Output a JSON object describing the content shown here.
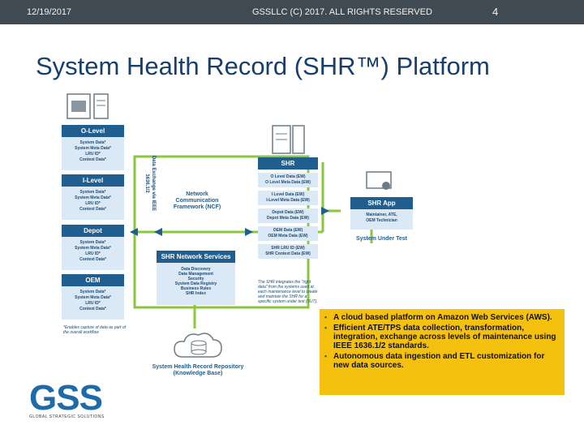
{
  "header": {
    "date": "12/19/2017",
    "copyright": "GSSLLC (C) 2017. ALL RIGHTS RESERVED",
    "page": "4"
  },
  "title": "System Health Record (SHR™) Platform",
  "diagram": {
    "levels": [
      {
        "name": "O-Level",
        "items": [
          "System Data*",
          "System Meta Data*",
          "LRU ID*",
          "Context Data*"
        ]
      },
      {
        "name": "I-Level",
        "items": [
          "System Data*",
          "System Meta Data*",
          "LRU ID*",
          "Context Data*"
        ]
      },
      {
        "name": "Depot",
        "items": [
          "System Data*",
          "System Meta Data*",
          "LRU ID*",
          "Context Data*"
        ]
      },
      {
        "name": "OEM",
        "items": [
          "System Data*",
          "System Meta Data*",
          "LRU ID*",
          "Context Data*"
        ]
      }
    ],
    "footnote": "*Enables capture of data as part of the overall workflow",
    "data_exchange": "Data Exchange via IEEE 1636.1/2",
    "ncf": "Network Communication Framework (NCF)",
    "shr_network_services": {
      "title": "SHR Network Services",
      "items": [
        "Data Discovery",
        "Data Management",
        "Security",
        "System Data Registry",
        "Business Rules",
        "SHR Index"
      ]
    },
    "shr": {
      "title": "SHR",
      "entries": [
        [
          "O Level Data (EW)",
          "O Level Meta Data (EW)"
        ],
        [
          "I Level Data (EW)",
          "I-Level Meta Data (EW)"
        ],
        [
          "Depot Data (EW)",
          "Depot Meta Data (EW)"
        ],
        [
          "OEM Data (EW)",
          "OEM Meta Data (EW)"
        ],
        [
          "SHR LRU ID (EW)",
          "SHR Context Data (EW)"
        ]
      ]
    },
    "shr_note": "The SHR integrates the \"right data\" from the systems used at each maintenance level to create and maintain the SHR for a specific system under test (SUT).",
    "shr_app": {
      "title": "SHR App",
      "items": [
        "Maintainer, ATE,",
        "OEM Technician"
      ]
    },
    "system_under_test": "System Under Test",
    "repository": "System Health Record Repository (Knowledge Base)"
  },
  "bullets": [
    "A cloud based platform on Amazon Web Services (AWS).",
    "Efficient ATE/TPS data collection, transformation, integration, exchange across levels of maintenance using IEEE 1636.1/2 standards.",
    "Autonomous data ingestion and ETL customization for new data sources."
  ],
  "logo": {
    "text": "GSS",
    "subtitle": "GLOBAL STRATEGIC SOLUTIONS"
  },
  "colors": {
    "header_bg": "#3f4a52",
    "title": "#173f6d",
    "box_header": "#1f5e8f",
    "box_body": "#dbe9f6",
    "connector": "#8cc63f",
    "callout": "#f4c10f"
  }
}
